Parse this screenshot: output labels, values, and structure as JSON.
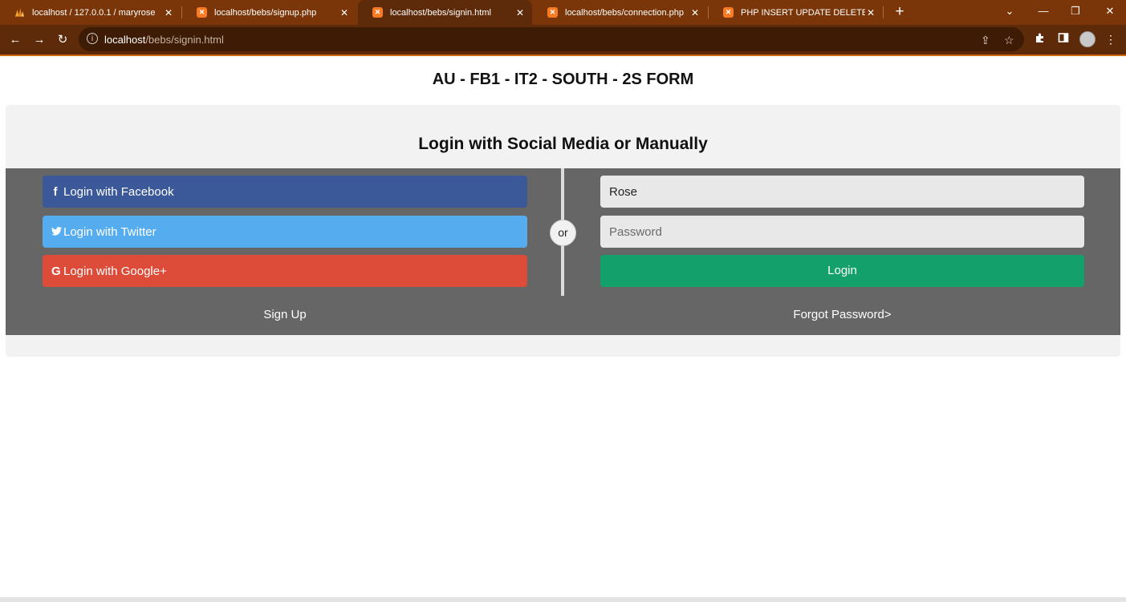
{
  "browser": {
    "tabs": [
      {
        "title": "localhost / 127.0.0.1 / maryrose",
        "icon": "phpmyadmin-icon",
        "active": false
      },
      {
        "title": "localhost/bebs/signup.php",
        "icon": "xampp-icon",
        "active": false
      },
      {
        "title": "localhost/bebs/signin.html",
        "icon": "xampp-icon",
        "active": true
      },
      {
        "title": "localhost/bebs/connection.php",
        "icon": "xampp-icon",
        "active": false
      },
      {
        "title": "PHP INSERT UPDATE DELETE SEA",
        "icon": "xampp-icon",
        "active": false
      }
    ],
    "close_glyph": "✕",
    "new_tab_glyph": "+",
    "url_host": "localhost",
    "url_path": "/bebs/signin.html",
    "colors": {
      "frame": "#7a3608",
      "toolbar": "#5e2b0a",
      "omnibox": "#3e1b04"
    }
  },
  "page": {
    "heading": "AU - FB1 - IT2 - SOUTH - 2S FORM"
  },
  "card": {
    "title": "Login with Social Media or Manually",
    "or_label": "or"
  },
  "social": {
    "facebook": {
      "icon": "f",
      "label": "Login with Facebook",
      "color": "#3b5998"
    },
    "twitter": {
      "icon": "🐦",
      "label": "Login with Twitter",
      "color": "#55acee"
    },
    "google": {
      "icon": "G",
      "label": "Login with Google+",
      "color": "#dd4b39"
    }
  },
  "form": {
    "username_value": "Rose",
    "password_placeholder": "Password",
    "login_label": "Login",
    "login_color": "#13a06a"
  },
  "links": {
    "signup": "Sign Up",
    "forgot": "Forgot Password>"
  }
}
